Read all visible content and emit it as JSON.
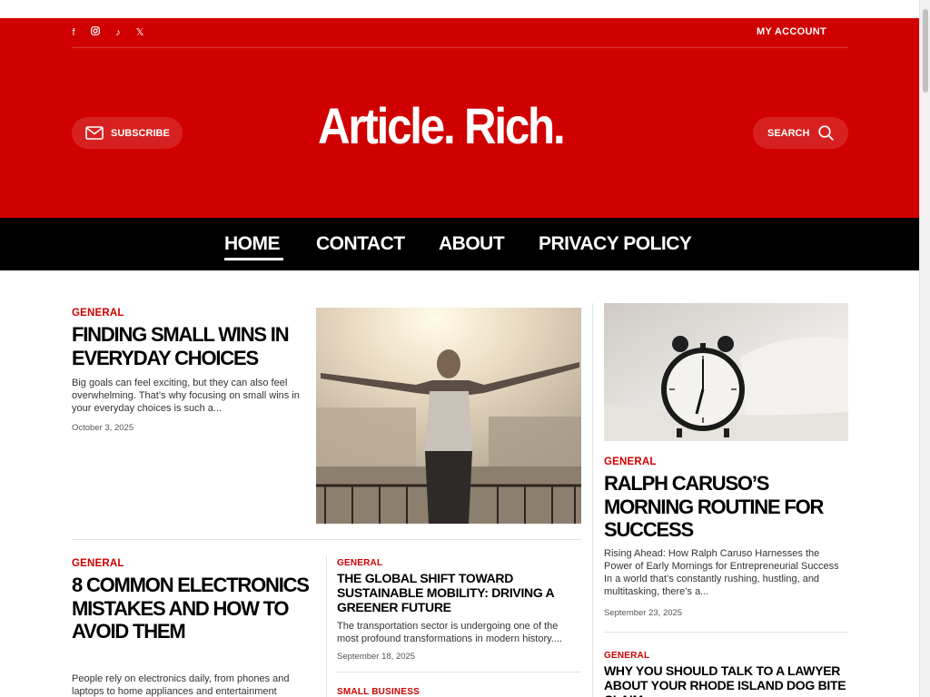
{
  "colors": {
    "brand_red": "#d10000",
    "nav_bg": "#000000",
    "text": "#000000"
  },
  "header": {
    "social_icons": [
      "facebook-icon",
      "instagram-icon",
      "tiktok-icon",
      "x-icon"
    ],
    "my_account": "MY ACCOUNT",
    "subscribe": "SUBSCRIBE",
    "search": "SEARCH",
    "logo": "Article. Rich."
  },
  "nav": {
    "items": [
      "HOME",
      "CONTACT",
      "ABOUT",
      "PRIVACY POLICY"
    ],
    "active": "HOME"
  },
  "featured": {
    "category": "GENERAL",
    "title": "FINDING SMALL WINS IN EVERYDAY CHOICES",
    "excerpt": "Big goals can feel exciting, but they can also feel overwhelming. That’s why focusing on small wins in your everyday choices is such a...",
    "date": "October 3, 2025"
  },
  "article2": {
    "category": "GENERAL",
    "title": "8 COMMON ELECTRONICS MISTAKES AND HOW TO AVOID THEM",
    "excerpt": "People rely on electronics daily, from phones and laptops to home appliances and entertainment"
  },
  "article3": {
    "category": "GENERAL",
    "title": "THE GLOBAL SHIFT TOWARD SUSTAINABLE MOBILITY: DRIVING A GREENER FUTURE",
    "excerpt": "The transportation sector is undergoing one of the most profound transformations in modern history....",
    "date": "September 18, 2025"
  },
  "article4": {
    "category": "SMALL BUSINESS"
  },
  "sidebar_article1": {
    "category": "GENERAL",
    "title": "RALPH CARUSO’S MORNING ROUTINE FOR SUCCESS",
    "excerpt": "Rising Ahead: How Ralph Caruso Harnesses the Power of Early Mornings for Entrepreneurial Success In a world that’s constantly rushing, hustling, and multitasking, there’s a...",
    "date": "September 23, 2025"
  },
  "sidebar_article2": {
    "category": "GENERAL",
    "title": "WHY YOU SHOULD TALK TO A LAWYER ABOUT YOUR RHODE ISLAND DOG BITE CLAIM"
  }
}
